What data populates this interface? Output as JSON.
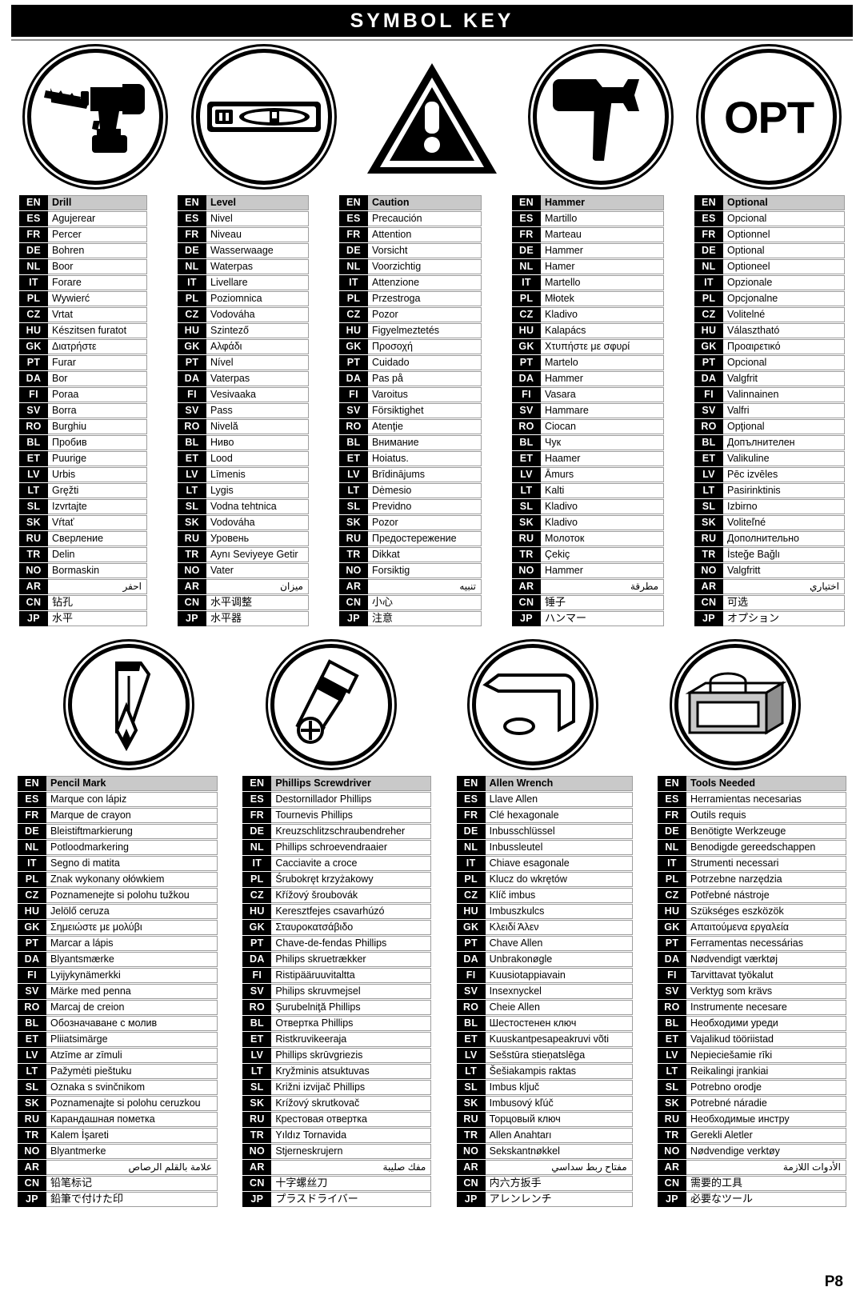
{
  "header": {
    "title": "SYMBOL KEY"
  },
  "footer": {
    "page_label": "P8"
  },
  "icons_top": [
    {
      "name": "drill-icon",
      "label": "Drill"
    },
    {
      "name": "level-icon",
      "label": "Level"
    },
    {
      "name": "caution-triangle-icon",
      "label": "Caution"
    },
    {
      "name": "hammer-icon",
      "label": "Hammer"
    },
    {
      "name": "optional-opt-icon",
      "label": "Optional",
      "text": "OPT"
    }
  ],
  "icons_bottom": [
    {
      "name": "pencil-icon",
      "label": "Pencil Mark"
    },
    {
      "name": "phillips-screwdriver-icon",
      "label": "Phillips Screwdriver"
    },
    {
      "name": "allen-wrench-icon",
      "label": "Allen Wrench"
    },
    {
      "name": "toolbox-icon",
      "label": "Tools Needed"
    }
  ],
  "language_codes": [
    "EN",
    "ES",
    "FR",
    "DE",
    "NL",
    "IT",
    "PL",
    "CZ",
    "HU",
    "GK",
    "PT",
    "DA",
    "FI",
    "SV",
    "RO",
    "BL",
    "ET",
    "LV",
    "LT",
    "SL",
    "SK",
    "RU",
    "TR",
    "NO",
    "AR",
    "CN",
    "JP"
  ],
  "tables_top": [
    {
      "key": "drill",
      "terms": [
        "Drill",
        "Agujerear",
        "Percer",
        "Bohren",
        "Boor",
        "Forare",
        "Wywierć",
        "Vrtat",
        "Készitsen furatot",
        "Διατρήστε",
        "Furar",
        "Bor",
        "Poraa",
        "Borra",
        "Burghiu",
        "Пробив",
        "Puurige",
        "Urbis",
        "Gręžti",
        "Izvrtajte",
        "Vŕtať",
        "Сверление",
        "Delin",
        "Bormaskin",
        "احفر",
        "钻孔",
        "水平"
      ]
    },
    {
      "key": "level",
      "terms": [
        "Level",
        "Nivel",
        "Niveau",
        "Wasserwaage",
        "Waterpas",
        "Livellare",
        "Poziomnica",
        "Vodováha",
        "Szintező",
        "Αλφάδι",
        "Nível",
        "Vaterpas",
        "Vesivaaka",
        "Pass",
        "Nivelă",
        "Ниво",
        "Lood",
        "Līmenis",
        "Lygis",
        "Vodna tehtnica",
        "Vodováha",
        "Уровень",
        "Aynı Seviyeye Getir",
        "Vater",
        "ميزان",
        "水平调整",
        "水平器"
      ]
    },
    {
      "key": "caution",
      "terms": [
        "Caution",
        "Precaución",
        "Attention",
        "Vorsicht",
        "Voorzichtig",
        "Attenzione",
        "Przestroga",
        "Pozor",
        "Figyelmeztetés",
        "Προσοχή",
        "Cuidado",
        "Pas på",
        "Varoitus",
        "Försiktighet",
        "Atenţie",
        "Внимание",
        "Hoiatus.",
        "Brīdinājums",
        "Dėmesio",
        "Previdno",
        "Pozor",
        "Предостережение",
        "Dikkat",
        "Forsiktig",
        "تنبيه",
        "小心",
        "注意"
      ]
    },
    {
      "key": "hammer",
      "terms": [
        "Hammer",
        "Martillo",
        "Marteau",
        "Hammer",
        "Hamer",
        "Martello",
        "Młotek",
        "Kladivo",
        "Kalapács",
        "Χτυπήστε με σφυρί",
        "Martelo",
        "Hammer",
        "Vasara",
        "Hammare",
        "Ciocan",
        "Чук",
        "Haamer",
        "Āmurs",
        "Kalti",
        "Kladivo",
        "Kladivo",
        "Молоток",
        "Çekiç",
        "Hammer",
        "مطرقة",
        "锤子",
        "ハンマー"
      ]
    },
    {
      "key": "optional",
      "terms": [
        "Optional",
        "Opcional",
        "Optionnel",
        "Optional",
        "Optioneel",
        "Opzionale",
        "Opcjonalne",
        "Volitelné",
        "Választható",
        "Προαιρετικό",
        "Opcional",
        "Valgfrit",
        "Valinnainen",
        "Valfri",
        "Opţional",
        "Допълнителен",
        "Valikuline",
        "Pēc izvēles",
        "Pasirinktinis",
        "Izbirno",
        "Voliteľné",
        "Дополнительно",
        "İsteğe Bağlı",
        "Valgfritt",
        "اختياري",
        "可选",
        "オプション"
      ]
    }
  ],
  "tables_bottom": [
    {
      "key": "pencil",
      "terms": [
        "Pencil Mark",
        "Marque con lápiz",
        "Marque de crayon",
        "Bleistiftmarkierung",
        "Potloodmarkering",
        "Segno di matita",
        "Znak wykonany ołówkiem",
        "Poznamenejte si polohu tužkou",
        "Jelölő ceruza",
        "Σημειώστε με μολύβι",
        "Marcar a lápis",
        "Blyantsmærke",
        "Lyijykynämerkki",
        "Märke med penna",
        "Marcaj de creion",
        "Обозначаване с молив",
        "Pliiatsimärge",
        "Atzīme ar zīmuli",
        "Pažymėti pieštuku",
        "Oznaka s svinčnikom",
        "Poznamenajte si polohu ceruzkou",
        "Карандашная пометка",
        "Kalem İşareti",
        "Blyantmerke",
        "علامة بالقلم الرصاص",
        "铅笔标记",
        "鉛筆で付けた印"
      ]
    },
    {
      "key": "phillips",
      "terms": [
        "Phillips Screwdriver",
        "Destornillador Phillips",
        "Tournevis Phillips",
        "Kreuzschlitzschraubendreher",
        "Phillips schroevendraaier",
        "Cacciavite a croce",
        "Śrubokręt krzyżakowy",
        "Křížový šroubovák",
        "Keresztfejes csavarhúzó",
        "Σταυροκατσάβιδο",
        "Chave-de-fendas Phillips",
        "Philips skruetrækker",
        "Ristipääruuvitaltta",
        "Philips skruvmejsel",
        "Şurubelniţă Phillips",
        "Отвертка Phillips",
        "Ristkruvikeeraja",
        "Phillips skrūvgriezis",
        "Kryžminis atsuktuvas",
        "Križni izvijač Phillips",
        "Krížový skrutkovač",
        "Крестовая отвертка",
        "Yıldız Tornavida",
        "Stjerneskrujern",
        "مفك صليبة",
        "十字螺丝刀",
        "プラスドライバー"
      ]
    },
    {
      "key": "allen",
      "terms": [
        "Allen Wrench",
        "Llave Allen",
        "Clé hexagonale",
        "Inbusschlüssel",
        "Inbussleutel",
        "Chiave esagonale",
        "Klucz do wkrętów",
        "Klíč imbus",
        "Imbuszkulcs",
        "Κλειδί Άλεν",
        "Chave Allen",
        "Unbrakonøgle",
        "Kuusiotappiavain",
        "Insexnyckel",
        "Cheie Allen",
        "Шестостенен ключ",
        "Kuuskantpesapeakruvi võti",
        "Sešstūra stieņatslēga",
        "Šešiakampis raktas",
        "Imbus ključ",
        "Imbusový kľúč",
        "Торцовый ключ",
        "Allen Anahtarı",
        "Sekskantnøkkel",
        "مفتاح ربط سداسي",
        "内六方扳手",
        "アレンレンチ"
      ]
    },
    {
      "key": "tools",
      "terms": [
        "Tools Needed",
        "Herramientas necesarias",
        "Outils requis",
        "Benötigte Werkzeuge",
        "Benodigde gereedschappen",
        "Strumenti necessari",
        "Potrzebne narzędzia",
        "Potřebné nástroje",
        "Szükséges eszközök",
        "Απαιτούμενα εργαλεία",
        "Ferramentas necessárias",
        "Nødvendigt værktøj",
        "Tarvittavat työkalut",
        "Verktyg som krävs",
        "Instrumente necesare",
        "Необходими уреди",
        "Vajalikud tööriistad",
        "Nepieciešamie rīki",
        "Reikalingi įrankiai",
        "Potrebno orodje",
        "Potrebné náradie",
        "Необходимые инстру",
        "Gerekli Aletler",
        "Nødvendige verktøy",
        "الأدوات اللازمة",
        "需要的工具",
        "必要なツール"
      ]
    }
  ]
}
